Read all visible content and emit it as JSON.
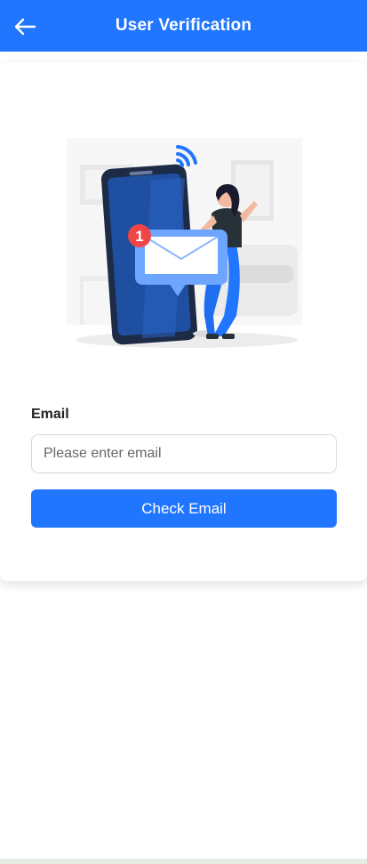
{
  "header": {
    "title": "User Verification",
    "back_icon": "arrow-left-icon"
  },
  "illustration": {
    "notification_count": "1",
    "icons": [
      "phone-icon",
      "envelope-icon",
      "wifi-signal-icon"
    ]
  },
  "form": {
    "email_label": "Email",
    "email_placeholder": "Please enter email",
    "email_value": "",
    "submit_label": "Check Email"
  },
  "colors": {
    "primary": "#2176ff",
    "badge": "#f04545",
    "phone_screen": "#1e4fa0"
  }
}
